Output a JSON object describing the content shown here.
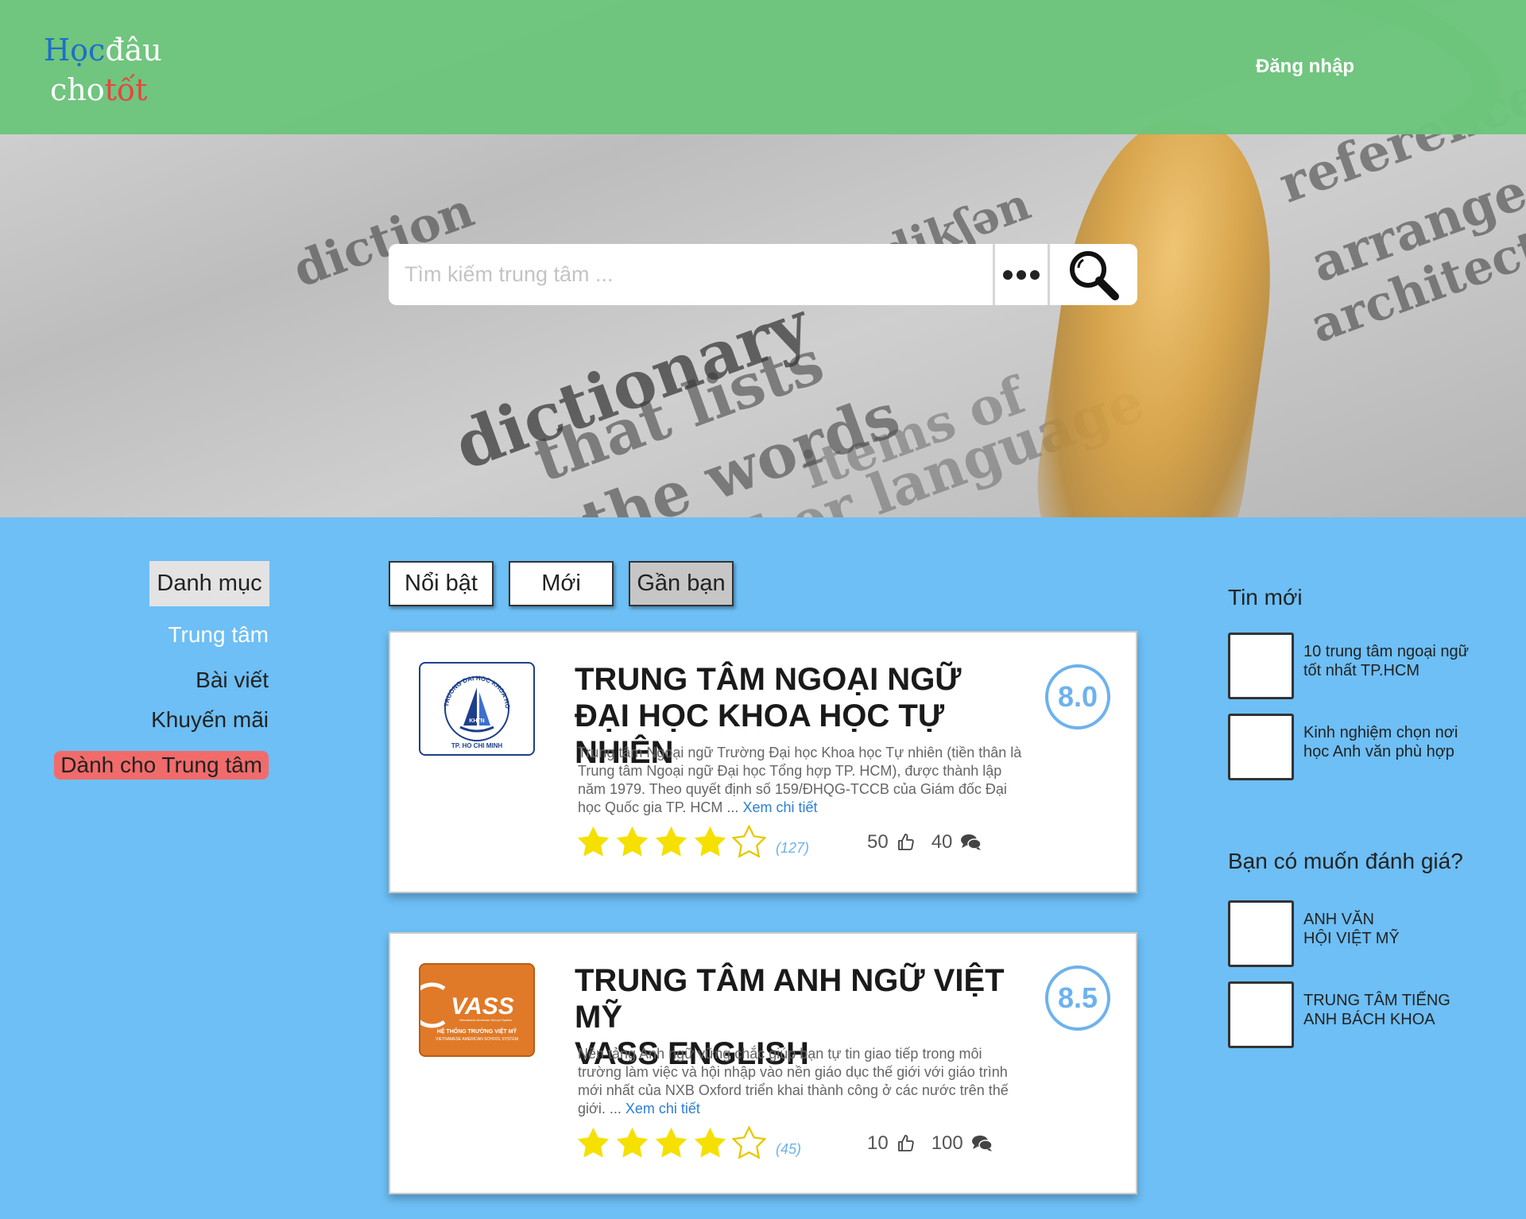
{
  "header": {
    "logo": {
      "part1": "Học",
      "part2": "đâu",
      "part3": "cho",
      "part4": "tốt"
    },
    "login_label": "Đăng nhập"
  },
  "search": {
    "placeholder": "Tìm kiếm trung tâm ..."
  },
  "categories": {
    "title": "Danh mục",
    "items": [
      {
        "label": "Trung tâm"
      },
      {
        "label": "Bài viết"
      },
      {
        "label": "Khuyến mãi"
      },
      {
        "label": "Dành cho Trung tâm"
      }
    ]
  },
  "tabs": [
    {
      "label": "Nổi bật"
    },
    {
      "label": "Mới"
    },
    {
      "label": "Gần bạn"
    }
  ],
  "selected_tab": "Gần bạn",
  "cards": [
    {
      "title_line1": "TRUNG TÂM NGOẠI NGỮ",
      "title_line2": "ĐẠI HỌC KHOA HỌC TỰ NHIÊN",
      "score": "8.0",
      "description": "Trung tâm Ngoại ngữ Trường Đại học Khoa học Tự nhiên (tiền thân là Trung tâm Ngoại ngữ Đại học Tổng hợp TP. HCM), được thành lập năm 1979. Theo quyết định số 159/ĐHQG-TCCB của Giám đốc Đại học Quốc gia TP. HCM ...",
      "more_link": "Xem chi tiết",
      "rating": 4,
      "rating_count": "(127)",
      "likes": "50",
      "comments": "40",
      "logo": {
        "ring_text": "TRUONG DAI HOC KHOA HOC TU NHIEN",
        "bottom_text": "TP. HO CHI MINH",
        "badge": "KHTN"
      }
    },
    {
      "title_line1": "TRUNG TÂM ANH NGỮ VIỆT MỸ",
      "title_line2": "VASS ENGLISH",
      "score": "8.5",
      "description": "Nền tảng Anh ngữ vững chắc giúp bạn tự tin giao tiếp trong môi trường làm việc và hội nhập vào nền giáo dục thế giới với giáo trình mới nhất của NXB Oxford triển khai thành công ở các nước trên thế giới. ...",
      "more_link": "Xem chi tiết",
      "rating": 4,
      "rating_count": "(45)",
      "likes": "10",
      "comments": "100",
      "logo": {
        "brand": "VASS",
        "tagline": "Vietnamese American School System",
        "line1": "HỆ THỐNG TRƯỜNG VIỆT MỸ",
        "line2": "VIETNAMESE AMERICAN SCHOOL SYSTEM",
        "color": "#e07a28"
      }
    }
  ],
  "sidebar": {
    "news_title": "Tin mới",
    "news": [
      {
        "text": "10 trung tâm ngoại ngữ tốt nhất TP.HCM"
      },
      {
        "text": "Kinh nghiệm chọn nơi học Anh văn phù hợp"
      }
    ],
    "review_title": "Bạn có muốn đánh giá?",
    "reviews": [
      {
        "line1": "ANH VĂN",
        "line2": "HỘI VIỆT MỸ"
      },
      {
        "line1": "TRUNG TÂM TIẾNG",
        "line2": "ANH BÁCH KHOA"
      }
    ]
  },
  "colors": {
    "header_bg": "#6cc47c",
    "page_bg": "#6dbff5",
    "accent_blue": "#6db2ee",
    "special_red": "#f26b6b",
    "star": "#f5e000"
  },
  "hero_background": {
    "words": [
      "diction",
      "dictionary",
      "that lists",
      "the words",
      "another language",
      "items of",
      "reference",
      "arrange",
      "architecture",
      "dikʃən"
    ]
  }
}
